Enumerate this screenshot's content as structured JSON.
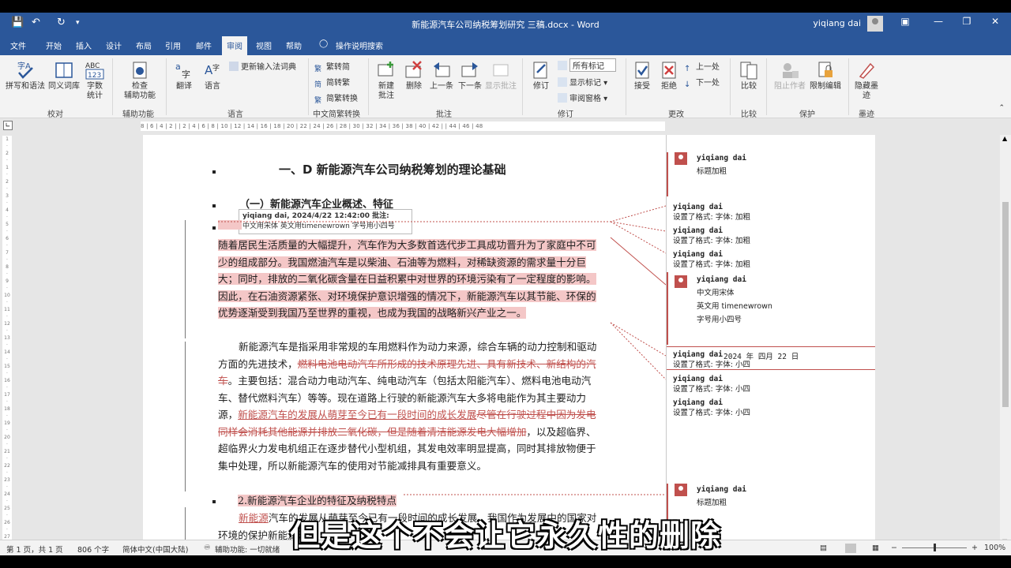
{
  "titlebar": {
    "doc_title": "新能源汽车公司纳税筹划研究 三稿.docx  -  Word",
    "user": "yiqiang dai",
    "colors": {
      "brand": "#2b579a"
    }
  },
  "tabs": [
    "文件",
    "开始",
    "插入",
    "设计",
    "布局",
    "引用",
    "邮件",
    "审阅",
    "视图",
    "帮助",
    "操作说明搜索"
  ],
  "ribbon": {
    "spelling": "拼写和语法",
    "thesaurus": "同义词库",
    "wordcount_1": "字数",
    "wordcount_2": "统计",
    "group_proofing": "校对",
    "accessibility_1": "检查",
    "accessibility_2": "辅助功能",
    "group_accessibility": "辅助功能",
    "translate": "翻译",
    "language": "语言",
    "update_ime": "更新输入法词典",
    "group_language": "语言",
    "to_traditional": "繁转简",
    "to_simplified": "简转繁",
    "convert": "简繁转换",
    "group_chinese": "中文简繁转换",
    "new_comment_1": "新建",
    "new_comment_2": "批注",
    "delete": "删除",
    "previous": "上一条",
    "next": "下一条",
    "show_comments": "显示批注",
    "group_comments": "批注",
    "track_changes": "修订",
    "markup_select": "所有标记",
    "show_markup": "显示标记",
    "review_pane": "审阅窗格",
    "group_tracking": "修订",
    "accept": "接受",
    "reject": "拒绝",
    "prev_change": "上一处",
    "next_change": "下一处",
    "group_changes": "更改",
    "compare": "比较",
    "group_compare": "比较",
    "block_authors": "阻止作者",
    "restrict_editing": "限制编辑",
    "group_protect": "保护",
    "hide_ink_1": "隐藏墨",
    "hide_ink_2": "迹",
    "group_ink": "墨迹"
  },
  "ruler_text": "8 | 6 | 4 | 2 |   | 2 | 4 | 6 | 8 | 10 | 12 | 14 | 16 | 18 | 20 | 22 | 24 | 26 | 28 | 30 | 32 | 34 | 36 | 38 | 40 | 42 |   | 44 | 46 | 48",
  "document": {
    "heading1": "一、D 新能源汽车公司纳税筹划的理论基础",
    "heading2": "（一）新能源汽车企业概述、特征",
    "tooltip_title": "yiqiang dai, 2024/4/22 12:42:00 批注:",
    "tooltip_body": "中文用宋体 英文用timenewrown 字号用小四号",
    "p1": "随着居民生活质量的大幅提升，汽车作为大多数首选代步工具成功晋升为了家庭中不可少的组成部分。我国燃油汽车是以柴油、石油等为燃料，对稀缺资源的需求量十分巨大；同时，排放的二氧化碳含量在日益积累中对世界的环境污染有了一定程度的影响。因此，在石油资源紧张、对环境保护意识增强的情况下，新能源汽车以其节能、环保的优势逐渐受到我国乃至世界的重视，也成为我国的战略新兴产业之一。",
    "p2_a": "新能源汽车是指采用非常规的车用燃料作为动力来源，综合车辆的动力控制和驱动方面的先进技术，",
    "p2_del1": "燃料电池电动汽车所形成的技术原理先进、具有新技术、新结构的汽车",
    "p2_b": "。主要包括：混合动力电动汽车、纯电动汽车（包括太阳能汽车）、燃料电池电动汽车、替代燃料汽车）等等。现在道路上行驶的新能源汽车大多将电能作为其主要动力源，",
    "p2_ins": "新能源汽车的发展从萌芽至今已有一段时间的成长发展",
    "p2_del2": "尽管在行驶过程中因为发电同样会消耗其他能源并排放二氧化碳，但是随着清洁能源发电大幅增加",
    "p2_c": "，以及超临界、超临界火力发电机组正在逐步替代小型机组，其发电效率明显提高，同时其排放物便于集中处理，所以新能源汽车的使用对节能减排具有重要意义。",
    "heading3": "2.新能源汽车企业的特征及纳税特点",
    "p3_ins": "新能源",
    "p3_a": "汽车的发展从萌芽至今已有一段时间的成长发展，我国作为发展中的国家对环境的保护",
    "p3_b": "新能源汽车"
  },
  "comments": [
    {
      "name": "yiqiang dai",
      "text": "标题加粗"
    },
    {
      "name": "yiqiang dai",
      "text": "设置了格式: 字体: 加粗"
    },
    {
      "name": "yiqiang dai",
      "text": "设置了格式: 字体: 加粗"
    },
    {
      "name": "yiqiang dai",
      "text": "设置了格式: 字体: 加粗"
    },
    {
      "name": "yiqiang dai",
      "line1": "中文用宋体",
      "line2": "英文用 timenewrown",
      "line3": "字号用小四号"
    },
    {
      "name": "yiqiang dai",
      "date": "2024 年 四月 22 日",
      "text": "设置了格式: 字体: 小四"
    },
    {
      "name": "yiqiang dai",
      "text": "设置了格式: 字体: 小四"
    },
    {
      "name": "yiqiang dai",
      "text": "设置了格式: 字体: 小四"
    },
    {
      "name": "yiqiang dai",
      "text": "标题加粗"
    }
  ],
  "status": {
    "page": "第 1 页，共 1 页",
    "words": "806 个字",
    "language": "简体中文(中国大陆)",
    "accessibility": "辅助功能: 一切就绪",
    "zoom": "100%"
  },
  "subtitle": "但是这个不会让它永久性的删除"
}
